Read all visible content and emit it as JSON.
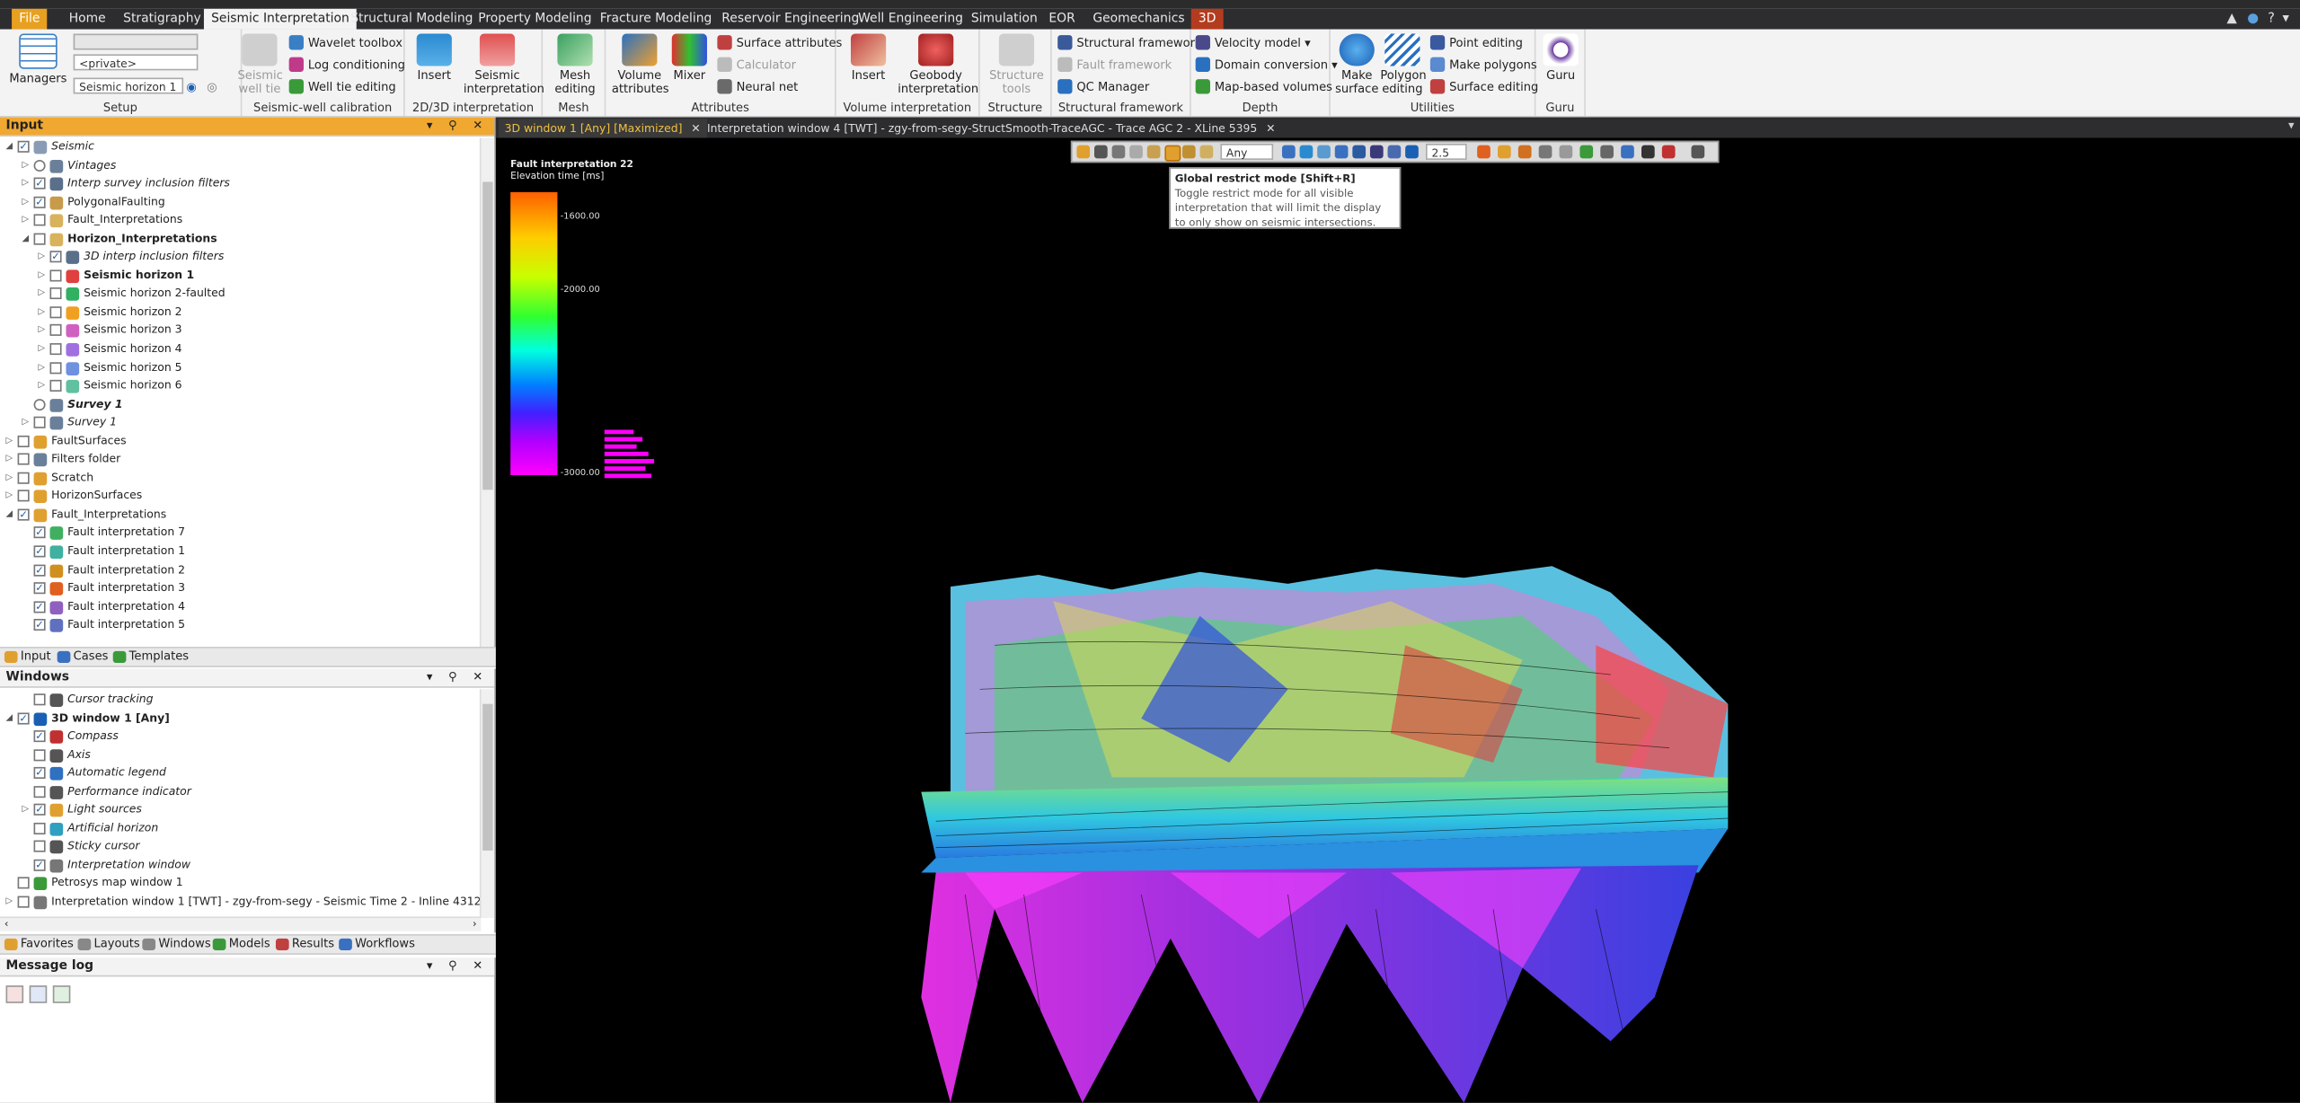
{
  "menu": {
    "tabs": [
      "File",
      "Home",
      "Stratigraphy",
      "Seismic Interpretation",
      "Structural Modeling",
      "Property Modeling",
      "Fracture Modeling",
      "Reservoir Engineering",
      "Well Engineering",
      "Simulation",
      "EOR",
      "Geomechanics",
      "3D"
    ],
    "active": "Seismic Interpretation"
  },
  "ribbon": {
    "setup": {
      "label": "Setup",
      "managers": "Managers",
      "private_combo": "<private>",
      "horizon_combo": "Seismic horizon 1"
    },
    "calibration": {
      "label": "Seismic-well calibration",
      "seismic_well_tie": "Seismic well tie",
      "wavelet_toolbox": "Wavelet toolbox",
      "log_conditioning": "Log conditioning",
      "well_tie_editing": "Well tie editing"
    },
    "interp2d3d": {
      "label": "2D/3D interpretation",
      "insert": "Insert",
      "seismic_interpretation": "Seismic interpretation"
    },
    "mesh": {
      "label": "Mesh",
      "mesh_editing": "Mesh editing"
    },
    "attributes": {
      "label": "Attributes",
      "volume_attributes": "Volume attributes",
      "mixer": "Mixer",
      "surface_attributes": "Surface attributes",
      "calculator": "Calculator",
      "neural_net": "Neural net"
    },
    "volume_interp": {
      "label": "Volume interpretation",
      "insert": "Insert",
      "geobody_interpretation": "Geobody interpretation"
    },
    "structure": {
      "label": "Structure",
      "structure_tools": "Structure tools"
    },
    "structural_framework": {
      "label": "Structural framework",
      "structural_framework": "Structural framework",
      "fault_framework": "Fault framework",
      "qc_manager": "QC Manager"
    },
    "depth": {
      "label": "Depth",
      "velocity_model": "Velocity model",
      "domain_conversion": "Domain conversion",
      "map_based_volumes": "Map-based volumes"
    },
    "utilities": {
      "label": "Utilities",
      "make_surface": "Make surface",
      "polygon_editing": "Polygon editing",
      "point_editing": "Point editing",
      "make_polygons": "Make polygons",
      "surface_editing": "Surface editing"
    },
    "guru": {
      "label": "Guru",
      "guru": "Guru"
    }
  },
  "input_panel": {
    "title": "Input",
    "items": [
      {
        "label": "Seismic",
        "level": 0,
        "exp": "◢",
        "checked": true,
        "style": "it",
        "color": "#8a9bb5"
      },
      {
        "label": "Vintages",
        "level": 1,
        "exp": "▷",
        "checked": null,
        "style": "it",
        "color": "#6a7f9a"
      },
      {
        "label": "Interp survey inclusion filters",
        "level": 1,
        "exp": "▷",
        "checked": true,
        "style": "it",
        "color": "#5a6f8a"
      },
      {
        "label": "PolygonalFaulting",
        "level": 1,
        "exp": "▷",
        "checked": true,
        "style": "",
        "color": "#c89b4a"
      },
      {
        "label": "Fault_Interpretations",
        "level": 1,
        "exp": "▷",
        "checked": false,
        "style": "",
        "color": "#d8b25c"
      },
      {
        "label": "Horizon_Interpretations",
        "level": 1,
        "exp": "◢",
        "checked": false,
        "style": "bd",
        "color": "#d8b25c"
      },
      {
        "label": "3D interp inclusion filters",
        "level": 2,
        "exp": "▷",
        "checked": true,
        "style": "it",
        "color": "#5a6f8a"
      },
      {
        "label": "Seismic horizon 1",
        "level": 2,
        "exp": "▷",
        "checked": false,
        "style": "bd",
        "color": "#e04040"
      },
      {
        "label": "Seismic horizon 2-faulted",
        "level": 2,
        "exp": "▷",
        "checked": false,
        "style": "",
        "color": "#30b060"
      },
      {
        "label": "Seismic horizon 2",
        "level": 2,
        "exp": "▷",
        "checked": false,
        "style": "",
        "color": "#f0a020"
      },
      {
        "label": "Seismic horizon 3",
        "level": 2,
        "exp": "▷",
        "checked": false,
        "style": "",
        "color": "#d060c0"
      },
      {
        "label": "Seismic horizon 4",
        "level": 2,
        "exp": "▷",
        "checked": false,
        "style": "",
        "color": "#a070e0"
      },
      {
        "label": "Seismic horizon 5",
        "level": 2,
        "exp": "▷",
        "checked": false,
        "style": "",
        "color": "#7090e0"
      },
      {
        "label": "Seismic horizon 6",
        "level": 2,
        "exp": "▷",
        "checked": false,
        "style": "",
        "color": "#60c0a0"
      },
      {
        "label": "Survey 1",
        "level": 1,
        "exp": "",
        "checked": null,
        "style": "it bd",
        "color": "#6a7f9a"
      },
      {
        "label": "Survey 1",
        "level": 1,
        "exp": "▷",
        "checked": false,
        "style": "it",
        "color": "#6a7f9a"
      },
      {
        "label": "FaultSurfaces",
        "level": 0,
        "exp": "▷",
        "checked": false,
        "style": "",
        "color": "#e0a030"
      },
      {
        "label": "Filters folder",
        "level": 0,
        "exp": "▷",
        "checked": false,
        "style": "",
        "color": "#6a7f9a"
      },
      {
        "label": "Scratch",
        "level": 0,
        "exp": "▷",
        "checked": false,
        "style": "",
        "color": "#e0a030"
      },
      {
        "label": "HorizonSurfaces",
        "level": 0,
        "exp": "▷",
        "checked": false,
        "style": "",
        "color": "#e0a030"
      },
      {
        "label": "Fault_Interpretations",
        "level": 0,
        "exp": "◢",
        "checked": true,
        "style": "",
        "color": "#e0a030"
      },
      {
        "label": "Fault interpretation 7",
        "level": 1,
        "exp": "",
        "checked": true,
        "style": "",
        "color": "#40b060"
      },
      {
        "label": "Fault interpretation 1",
        "level": 1,
        "exp": "",
        "checked": true,
        "style": "",
        "color": "#40b0a0"
      },
      {
        "label": "Fault interpretation 2",
        "level": 1,
        "exp": "",
        "checked": true,
        "style": "",
        "color": "#d09020"
      },
      {
        "label": "Fault interpretation 3",
        "level": 1,
        "exp": "",
        "checked": true,
        "style": "",
        "color": "#e06020"
      },
      {
        "label": "Fault interpretation 4",
        "level": 1,
        "exp": "",
        "checked": true,
        "style": "",
        "color": "#9060c0"
      },
      {
        "label": "Fault interpretation 5",
        "level": 1,
        "exp": "",
        "checked": true,
        "style": "",
        "color": "#6070c0"
      }
    ]
  },
  "input_tabs": [
    "Input",
    "Cases",
    "Templates"
  ],
  "windows_panel": {
    "title": "Windows",
    "items": [
      {
        "label": "Cursor tracking",
        "level": 1,
        "exp": "",
        "checked": false,
        "style": "it",
        "color": "#555"
      },
      {
        "label": "3D window 1 [Any]",
        "level": 0,
        "exp": "◢",
        "checked": true,
        "style": "bd",
        "color": "#1a5fb4"
      },
      {
        "label": "Compass",
        "level": 1,
        "exp": "",
        "checked": true,
        "style": "it",
        "color": "#c03030"
      },
      {
        "label": "Axis",
        "level": 1,
        "exp": "",
        "checked": false,
        "style": "it",
        "color": "#555"
      },
      {
        "label": "Automatic legend",
        "level": 1,
        "exp": "",
        "checked": true,
        "style": "it",
        "color": "#3070c0"
      },
      {
        "label": "Performance indicator",
        "level": 1,
        "exp": "",
        "checked": false,
        "style": "it",
        "color": "#555"
      },
      {
        "label": "Light sources",
        "level": 1,
        "exp": "▷",
        "checked": true,
        "style": "it",
        "color": "#e0a030"
      },
      {
        "label": "Artificial horizon",
        "level": 1,
        "exp": "",
        "checked": false,
        "style": "it",
        "color": "#30a0c0"
      },
      {
        "label": "Sticky cursor",
        "level": 1,
        "exp": "",
        "checked": false,
        "style": "it",
        "color": "#555"
      },
      {
        "label": "Interpretation window",
        "level": 1,
        "exp": "",
        "checked": true,
        "style": "it",
        "color": "#777"
      },
      {
        "label": "Petrosys map window 1",
        "level": 0,
        "exp": "",
        "checked": false,
        "style": "",
        "color": "#3a9a3a"
      },
      {
        "label": "Interpretation window 1 [TWT] - zgy-from-segy - Seismic Time 2 - Inline 4312",
        "level": 0,
        "exp": "▷",
        "checked": false,
        "style": "",
        "color": "#777"
      }
    ]
  },
  "bottom_tabs": [
    "Favorites",
    "Layouts",
    "Windows",
    "Models",
    "Results",
    "Workflows"
  ],
  "message_log": {
    "title": "Message log"
  },
  "view_tabs": [
    {
      "label": "3D window 1 [Any] [Maximized]",
      "active": true
    },
    {
      "label": "Interpretation window 4 [TWT] - zgy-from-segy-StructSmooth-TraceAGC - Trace AGC 2 - XLine 5395",
      "active": false
    }
  ],
  "toolbar": {
    "domain_value": "Any",
    "zscale_value": "2.5"
  },
  "tooltip": {
    "title": "Global restrict mode [Shift+R]",
    "body": "Toggle restrict mode for all visible interpretation that will limit the display to only show on seismic intersections."
  },
  "legend": {
    "title": "Fault interpretation 22",
    "subtitle": "Elevation time [ms]",
    "ticks": [
      "-1600.00",
      "-2000.00",
      "-3000.00"
    ]
  }
}
